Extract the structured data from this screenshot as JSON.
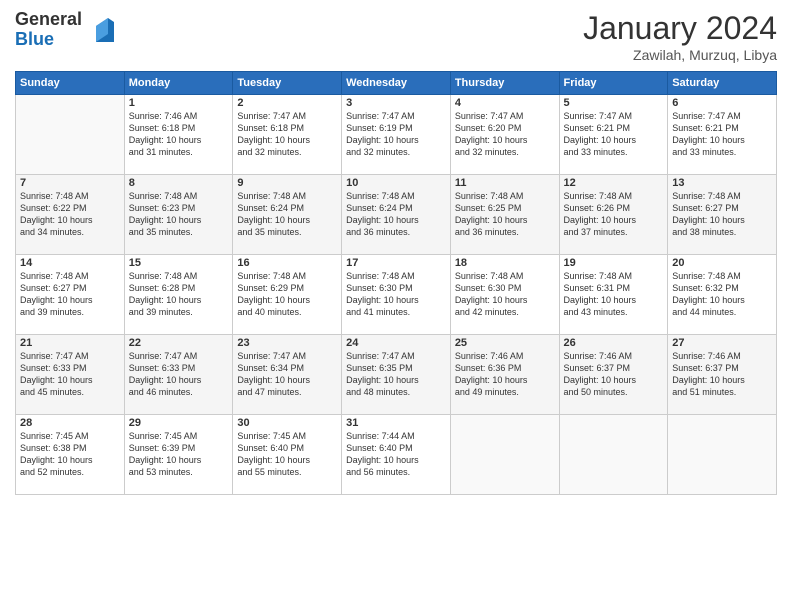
{
  "logo": {
    "general": "General",
    "blue": "Blue"
  },
  "title": "January 2024",
  "subtitle": "Zawilah, Murzuq, Libya",
  "headers": [
    "Sunday",
    "Monday",
    "Tuesday",
    "Wednesday",
    "Thursday",
    "Friday",
    "Saturday"
  ],
  "weeks": [
    [
      {
        "day": "",
        "info": ""
      },
      {
        "day": "1",
        "info": "Sunrise: 7:46 AM\nSunset: 6:18 PM\nDaylight: 10 hours\nand 31 minutes."
      },
      {
        "day": "2",
        "info": "Sunrise: 7:47 AM\nSunset: 6:18 PM\nDaylight: 10 hours\nand 32 minutes."
      },
      {
        "day": "3",
        "info": "Sunrise: 7:47 AM\nSunset: 6:19 PM\nDaylight: 10 hours\nand 32 minutes."
      },
      {
        "day": "4",
        "info": "Sunrise: 7:47 AM\nSunset: 6:20 PM\nDaylight: 10 hours\nand 32 minutes."
      },
      {
        "day": "5",
        "info": "Sunrise: 7:47 AM\nSunset: 6:21 PM\nDaylight: 10 hours\nand 33 minutes."
      },
      {
        "day": "6",
        "info": "Sunrise: 7:47 AM\nSunset: 6:21 PM\nDaylight: 10 hours\nand 33 minutes."
      }
    ],
    [
      {
        "day": "7",
        "info": "Sunrise: 7:48 AM\nSunset: 6:22 PM\nDaylight: 10 hours\nand 34 minutes."
      },
      {
        "day": "8",
        "info": "Sunrise: 7:48 AM\nSunset: 6:23 PM\nDaylight: 10 hours\nand 35 minutes."
      },
      {
        "day": "9",
        "info": "Sunrise: 7:48 AM\nSunset: 6:24 PM\nDaylight: 10 hours\nand 35 minutes."
      },
      {
        "day": "10",
        "info": "Sunrise: 7:48 AM\nSunset: 6:24 PM\nDaylight: 10 hours\nand 36 minutes."
      },
      {
        "day": "11",
        "info": "Sunrise: 7:48 AM\nSunset: 6:25 PM\nDaylight: 10 hours\nand 36 minutes."
      },
      {
        "day": "12",
        "info": "Sunrise: 7:48 AM\nSunset: 6:26 PM\nDaylight: 10 hours\nand 37 minutes."
      },
      {
        "day": "13",
        "info": "Sunrise: 7:48 AM\nSunset: 6:27 PM\nDaylight: 10 hours\nand 38 minutes."
      }
    ],
    [
      {
        "day": "14",
        "info": "Sunrise: 7:48 AM\nSunset: 6:27 PM\nDaylight: 10 hours\nand 39 minutes."
      },
      {
        "day": "15",
        "info": "Sunrise: 7:48 AM\nSunset: 6:28 PM\nDaylight: 10 hours\nand 39 minutes."
      },
      {
        "day": "16",
        "info": "Sunrise: 7:48 AM\nSunset: 6:29 PM\nDaylight: 10 hours\nand 40 minutes."
      },
      {
        "day": "17",
        "info": "Sunrise: 7:48 AM\nSunset: 6:30 PM\nDaylight: 10 hours\nand 41 minutes."
      },
      {
        "day": "18",
        "info": "Sunrise: 7:48 AM\nSunset: 6:30 PM\nDaylight: 10 hours\nand 42 minutes."
      },
      {
        "day": "19",
        "info": "Sunrise: 7:48 AM\nSunset: 6:31 PM\nDaylight: 10 hours\nand 43 minutes."
      },
      {
        "day": "20",
        "info": "Sunrise: 7:48 AM\nSunset: 6:32 PM\nDaylight: 10 hours\nand 44 minutes."
      }
    ],
    [
      {
        "day": "21",
        "info": "Sunrise: 7:47 AM\nSunset: 6:33 PM\nDaylight: 10 hours\nand 45 minutes."
      },
      {
        "day": "22",
        "info": "Sunrise: 7:47 AM\nSunset: 6:33 PM\nDaylight: 10 hours\nand 46 minutes."
      },
      {
        "day": "23",
        "info": "Sunrise: 7:47 AM\nSunset: 6:34 PM\nDaylight: 10 hours\nand 47 minutes."
      },
      {
        "day": "24",
        "info": "Sunrise: 7:47 AM\nSunset: 6:35 PM\nDaylight: 10 hours\nand 48 minutes."
      },
      {
        "day": "25",
        "info": "Sunrise: 7:46 AM\nSunset: 6:36 PM\nDaylight: 10 hours\nand 49 minutes."
      },
      {
        "day": "26",
        "info": "Sunrise: 7:46 AM\nSunset: 6:37 PM\nDaylight: 10 hours\nand 50 minutes."
      },
      {
        "day": "27",
        "info": "Sunrise: 7:46 AM\nSunset: 6:37 PM\nDaylight: 10 hours\nand 51 minutes."
      }
    ],
    [
      {
        "day": "28",
        "info": "Sunrise: 7:45 AM\nSunset: 6:38 PM\nDaylight: 10 hours\nand 52 minutes."
      },
      {
        "day": "29",
        "info": "Sunrise: 7:45 AM\nSunset: 6:39 PM\nDaylight: 10 hours\nand 53 minutes."
      },
      {
        "day": "30",
        "info": "Sunrise: 7:45 AM\nSunset: 6:40 PM\nDaylight: 10 hours\nand 55 minutes."
      },
      {
        "day": "31",
        "info": "Sunrise: 7:44 AM\nSunset: 6:40 PM\nDaylight: 10 hours\nand 56 minutes."
      },
      {
        "day": "",
        "info": ""
      },
      {
        "day": "",
        "info": ""
      },
      {
        "day": "",
        "info": ""
      }
    ]
  ]
}
